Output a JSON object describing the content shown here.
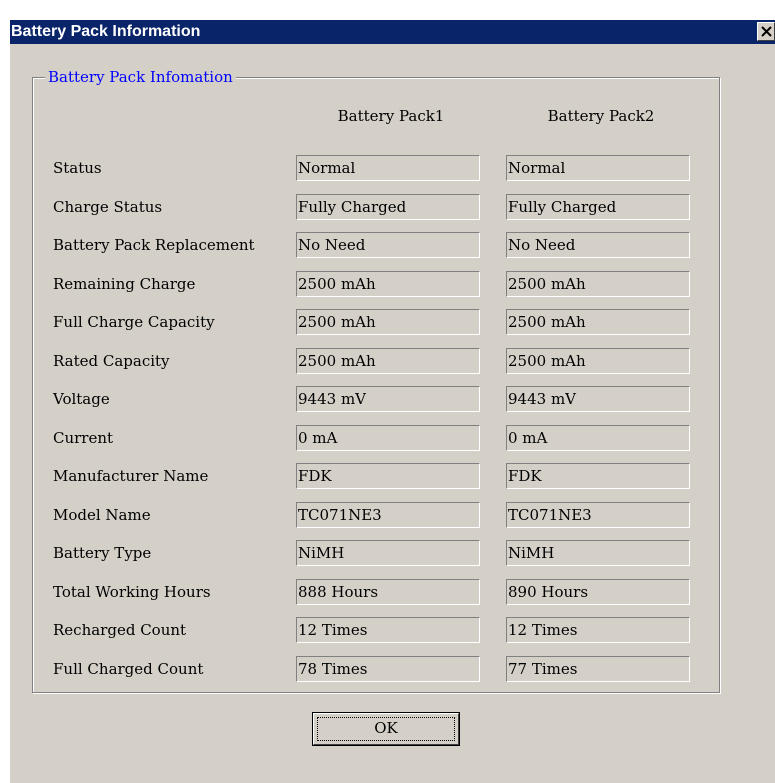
{
  "window": {
    "title": "Battery Pack Information",
    "close_icon": "close-icon"
  },
  "group": {
    "legend": "Battery Pack Infomation",
    "columns": [
      "Battery Pack1",
      "Battery Pack2"
    ],
    "rows": [
      {
        "label": "Status",
        "pack1": "Normal",
        "pack2": "Normal"
      },
      {
        "label": "Charge Status",
        "pack1": "Fully Charged",
        "pack2": "Fully Charged"
      },
      {
        "label": "Battery Pack Replacement",
        "pack1": "No Need",
        "pack2": "No Need"
      },
      {
        "label": "Remaining Charge",
        "pack1": "2500 mAh",
        "pack2": "2500 mAh"
      },
      {
        "label": "Full Charge Capacity",
        "pack1": "2500 mAh",
        "pack2": "2500 mAh"
      },
      {
        "label": "Rated Capacity",
        "pack1": "2500 mAh",
        "pack2": "2500 mAh"
      },
      {
        "label": "Voltage",
        "pack1": "9443 mV",
        "pack2": "9443 mV"
      },
      {
        "label": "Current",
        "pack1": "0 mA",
        "pack2": "0 mA"
      },
      {
        "label": "Manufacturer Name",
        "pack1": "FDK",
        "pack2": "FDK"
      },
      {
        "label": "Model Name",
        "pack1": "TC071NE3",
        "pack2": "TC071NE3"
      },
      {
        "label": "Battery Type",
        "pack1": "NiMH",
        "pack2": "NiMH"
      },
      {
        "label": "Total Working Hours",
        "pack1": "888 Hours",
        "pack2": "890 Hours"
      },
      {
        "label": "Recharged Count",
        "pack1": "12 Times",
        "pack2": "12 Times"
      },
      {
        "label": "Full Charged Count",
        "pack1": "78 Times",
        "pack2": "77 Times"
      }
    ]
  },
  "buttons": {
    "ok_label": "OK"
  },
  "colors": {
    "titlebar": "#0a246a",
    "dialog_bg": "#d4d0c8",
    "legend_text": "#0000ff"
  }
}
